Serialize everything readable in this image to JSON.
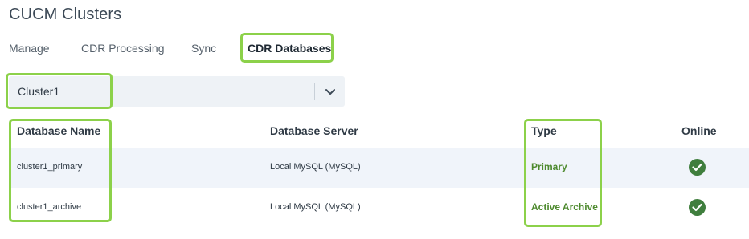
{
  "page": {
    "title": "CUCM Clusters"
  },
  "tabs": [
    {
      "label": "Manage"
    },
    {
      "label": "CDR Processing"
    },
    {
      "label": "Sync"
    },
    {
      "label": "CDR Databases",
      "active": true
    }
  ],
  "cluster_select": {
    "value": "Cluster1",
    "icon": "chevron-down-icon"
  },
  "table": {
    "columns": [
      "Database Name",
      "Database Server",
      "Type",
      "Online"
    ],
    "rows": [
      {
        "name": "cluster1_primary",
        "server": "Local MySQL (MySQL)",
        "type": "Primary",
        "online": true
      },
      {
        "name": "cluster1_archive",
        "server": "Local MySQL (MySQL)",
        "type": "Active Archive",
        "online": true
      }
    ]
  },
  "colors": {
    "highlight": "#8cd14a",
    "type_text": "#4e8a2f",
    "online_icon": "#3f7e3d",
    "row_alt": "#f0f4fa"
  }
}
